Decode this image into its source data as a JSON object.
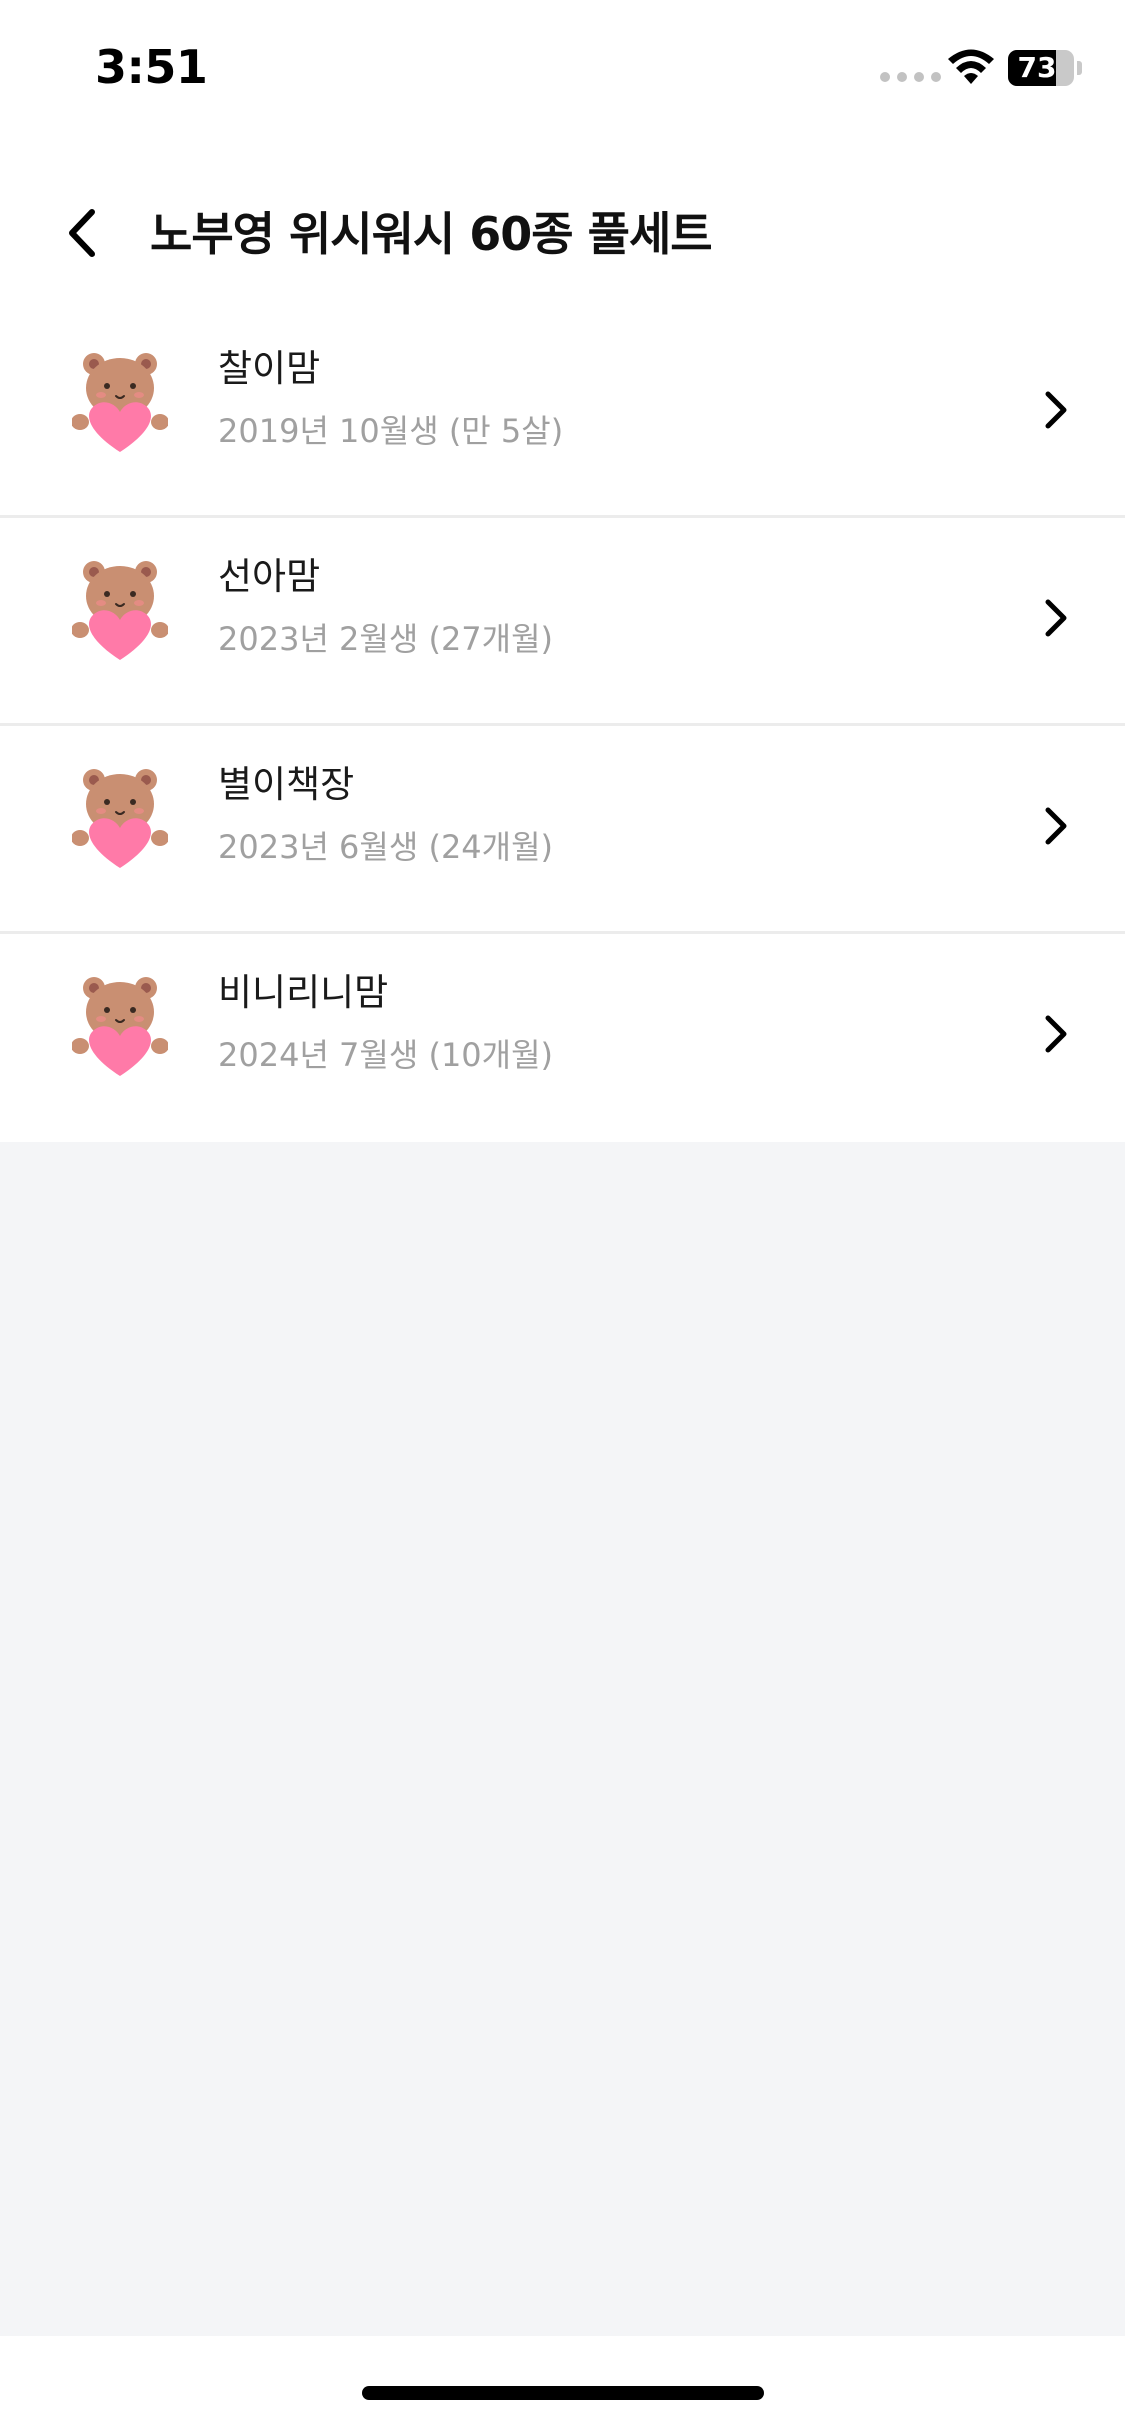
{
  "status_bar": {
    "time": "3:51",
    "battery_percent": "73",
    "battery_level": 0.73
  },
  "header": {
    "title": "노부영 위시워시 60종 풀세트",
    "back_icon": "chevron-left-icon"
  },
  "list": {
    "items": [
      {
        "name": "찰이맘",
        "subtitle": "2019년 10월생 (만 5살)",
        "avatar_icon": "bear-heart-avatar"
      },
      {
        "name": "선아맘",
        "subtitle": "2023년 2월생 (27개월)",
        "avatar_icon": "bear-heart-avatar"
      },
      {
        "name": "별이책장",
        "subtitle": "2023년 6월생 (24개월)",
        "avatar_icon": "bear-heart-avatar"
      },
      {
        "name": "비니리니맘",
        "subtitle": "2024년 7월생 (10개월)",
        "avatar_icon": "bear-heart-avatar"
      }
    ]
  },
  "colors": {
    "background": "#f4f5f7",
    "surface": "#ffffff",
    "secondary_text": "#a0a0a0",
    "avatar_heart": "#ff7aa8",
    "avatar_bear": "#c98f72"
  }
}
